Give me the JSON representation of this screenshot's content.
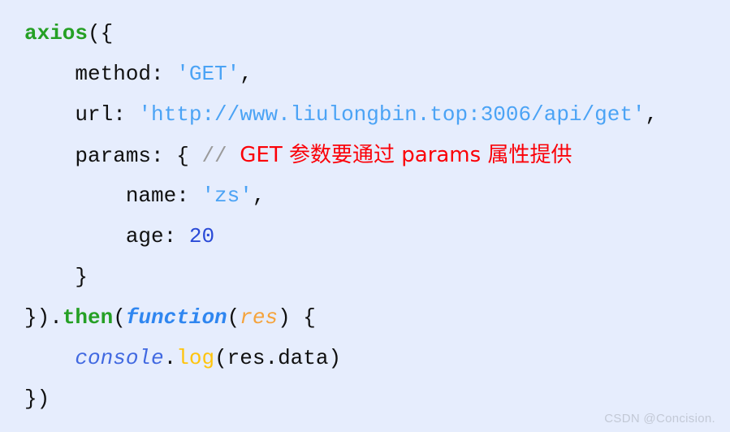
{
  "editor": {
    "background_color": "#e6edfd",
    "font_size_px": 26,
    "line_height_px": 50,
    "language": "javascript"
  },
  "palette": {
    "plain": "#101010",
    "keyword_green": "#25a025",
    "string_blue": "#4ba3f5",
    "number_blue": "#2a4ad7",
    "comment_slash_gray": "#9a9a9a",
    "comment_red": "#fb0007",
    "function_blue": "#2f86f0",
    "param_orange": "#f5a33c",
    "object_blue": "#4169e1",
    "method_gold": "#ffc40c"
  },
  "code": {
    "lines": [
      {
        "indent": 0,
        "tokens": [
          {
            "text": "axios",
            "type": "keyword"
          },
          {
            "text": "({",
            "type": "plain"
          }
        ]
      },
      {
        "indent": 1,
        "tokens": [
          {
            "text": "method: ",
            "type": "plain"
          },
          {
            "text": "'GET'",
            "type": "string"
          },
          {
            "text": ",",
            "type": "plain"
          }
        ]
      },
      {
        "indent": 1,
        "tokens": [
          {
            "text": "url: ",
            "type": "plain"
          },
          {
            "text": "'http://www.liulongbin.top:3006/api/get'",
            "type": "string"
          },
          {
            "text": ",",
            "type": "plain"
          }
        ]
      },
      {
        "indent": 1,
        "tokens": [
          {
            "text": "params: { ",
            "type": "plain"
          },
          {
            "text": "// ",
            "type": "comment-slash"
          },
          {
            "text": "GET 参数要通过 params 属性提供",
            "type": "comment"
          }
        ]
      },
      {
        "indent": 2,
        "tokens": [
          {
            "text": "name: ",
            "type": "plain"
          },
          {
            "text": "'zs'",
            "type": "string"
          },
          {
            "text": ",",
            "type": "plain"
          }
        ]
      },
      {
        "indent": 2,
        "tokens": [
          {
            "text": "age: ",
            "type": "plain"
          },
          {
            "text": "20",
            "type": "number"
          }
        ]
      },
      {
        "indent": 1,
        "tokens": [
          {
            "text": "}",
            "type": "plain"
          }
        ]
      },
      {
        "indent": 0,
        "tokens": [
          {
            "text": "}).",
            "type": "plain"
          },
          {
            "text": "then",
            "type": "keyword"
          },
          {
            "text": "(",
            "type": "plain"
          },
          {
            "text": "function",
            "type": "function"
          },
          {
            "text": "(",
            "type": "plain"
          },
          {
            "text": "res",
            "type": "param"
          },
          {
            "text": ") {",
            "type": "plain"
          }
        ]
      },
      {
        "indent": 1,
        "tokens": [
          {
            "text": "console",
            "type": "object"
          },
          {
            "text": ".",
            "type": "plain"
          },
          {
            "text": "log",
            "type": "method"
          },
          {
            "text": "(res.data)",
            "type": "plain"
          }
        ]
      },
      {
        "indent": 0,
        "tokens": [
          {
            "text": "})",
            "type": "plain"
          }
        ]
      }
    ]
  },
  "watermark": {
    "text": "CSDN @Concision."
  }
}
